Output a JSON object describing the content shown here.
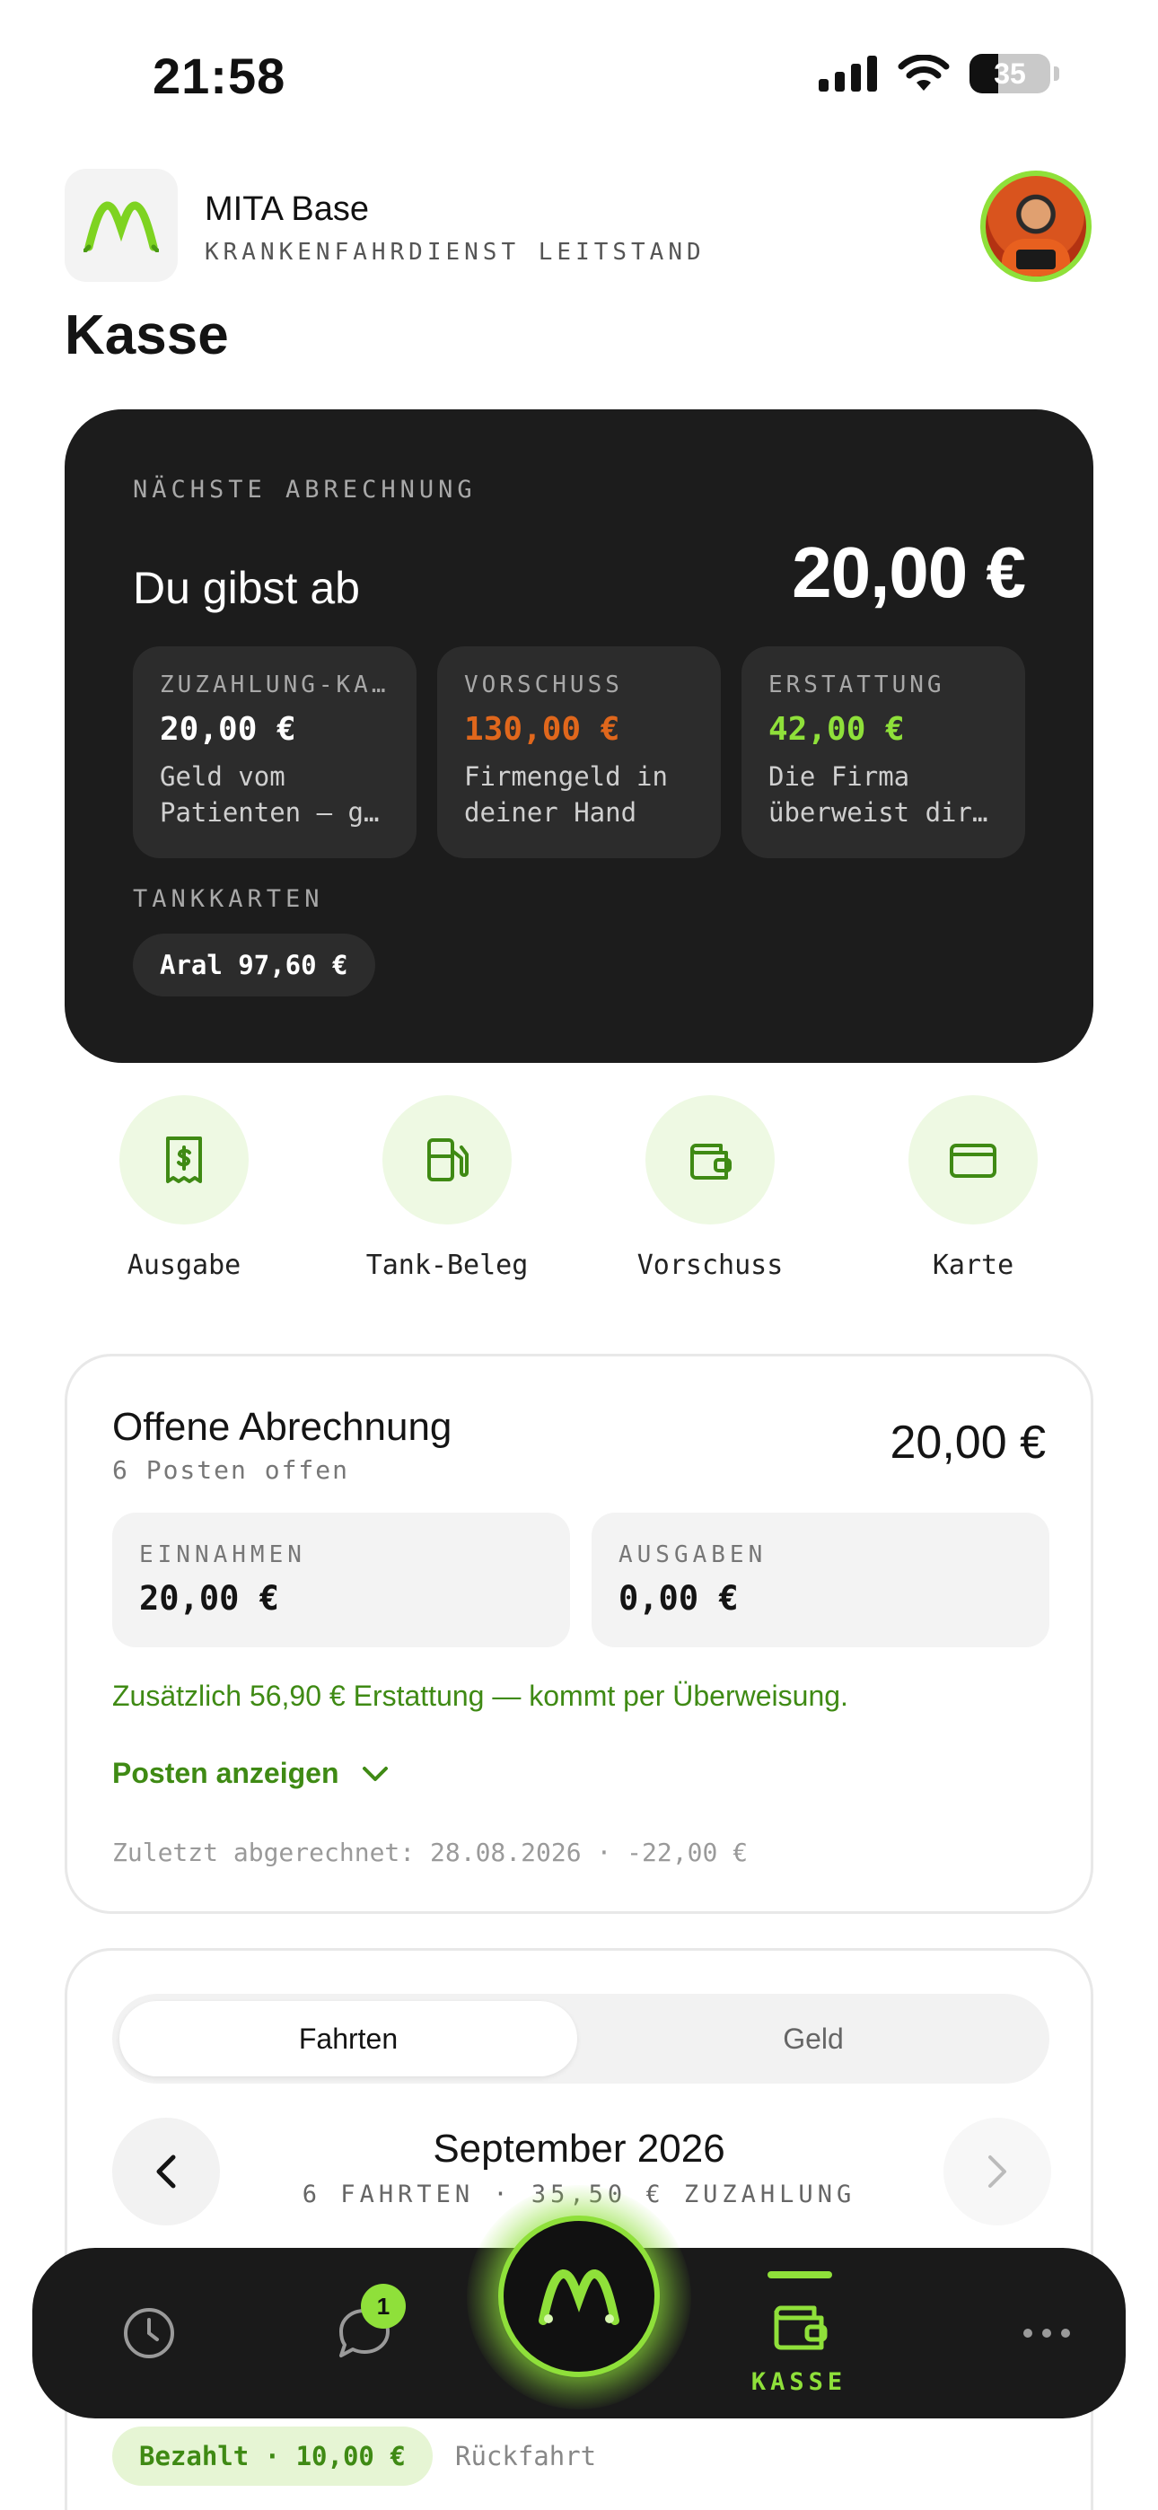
{
  "status_bar": {
    "time": "21:58",
    "battery": "35"
  },
  "header": {
    "app_name": "MITA Base",
    "app_subtitle": "KRANKENFAHRDIENST LEITSTAND",
    "page_title": "Kasse"
  },
  "summary": {
    "label": "NÄCHSTE ABRECHNUNG",
    "headline": "Du gibst ab",
    "amount": "20,00 €",
    "cards": [
      {
        "title": "ZUZAHLUNG-KA…",
        "value": "20,00 €",
        "desc": "Geld vom Patienten — g…",
        "color": "#ffffff"
      },
      {
        "title": "VORSCHUSS",
        "value": "130,00 €",
        "desc": "Firmengeld in deiner Hand",
        "color": "#e0671c"
      },
      {
        "title": "ERSTATTUNG",
        "value": "42,00 €",
        "desc": "Die Firma überweist dir…",
        "color": "#8fe03a"
      }
    ],
    "tank_label": "TANKKARTEN",
    "tank_chip": "Aral 97,60 €"
  },
  "actions": [
    {
      "label": "Ausgabe",
      "icon": "receipt-dollar-icon"
    },
    {
      "label": "Tank-Beleg",
      "icon": "fuel-pump-icon"
    },
    {
      "label": "Vorschuss",
      "icon": "wallet-icon"
    },
    {
      "label": "Karte",
      "icon": "credit-card-icon"
    }
  ],
  "open_statement": {
    "title": "Offene Abrechnung",
    "subtitle": "6 Posten offen",
    "amount": "20,00 €",
    "income_label": "EINNAHMEN",
    "income_value": "20,00 €",
    "expense_label": "AUSGABEN",
    "expense_value": "0,00 €",
    "refund_note": "Zusätzlich 56,90 € Erstattung — kommt per Überweisung.",
    "toggle_label": "Posten anzeigen",
    "last_settled": "Zuletzt abgerechnet: 28.08.2026 · -22,00 €"
  },
  "rides": {
    "tabs": [
      "Fahrten",
      "Geld"
    ],
    "active_tab": "Fahrten",
    "month": "September 2026",
    "month_summary": "6 FAHRTEN · 35,50 € ZUZAHLUNG",
    "first_item_chip": "Bezahlt · 10,00 €",
    "first_item_direction": "Rückfahrt"
  },
  "tabbar": {
    "items": [
      "clock-icon",
      "chat-icon",
      "home-logo",
      "wallet-icon",
      "more-icon"
    ],
    "chat_badge": "1",
    "active_label": "KASSE"
  },
  "colors": {
    "accent": "#8fe03a",
    "accent_dark": "#3f8a14",
    "advance": "#e0671c",
    "card_dark": "#1c1c1c"
  }
}
